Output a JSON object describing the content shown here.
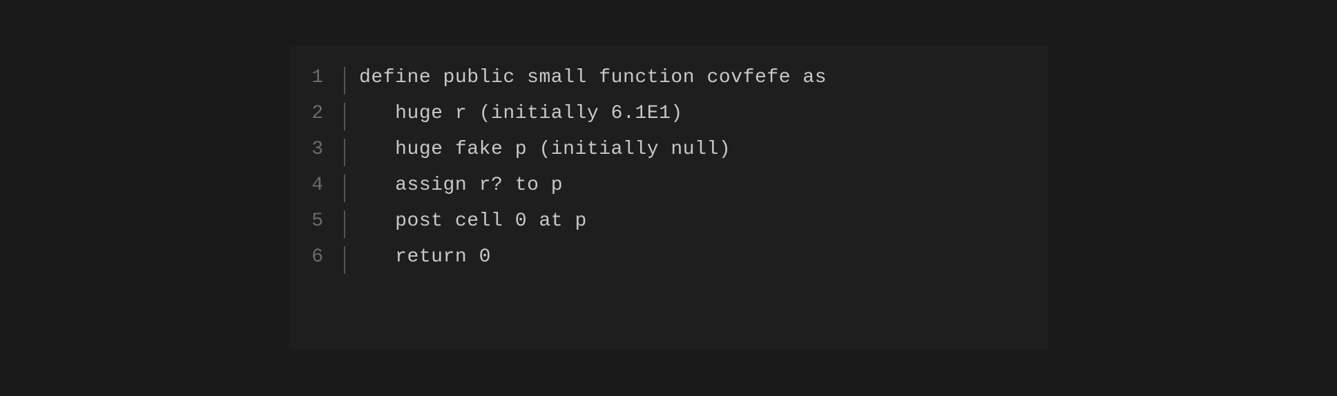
{
  "editor": {
    "background": "#1e1e1e",
    "lines": [
      {
        "number": "1",
        "content": "define public small function covfefe as",
        "indented": false
      },
      {
        "number": "2",
        "content": "   huge r (initially 6.1E1)",
        "indented": true
      },
      {
        "number": "3",
        "content": "   huge fake p (initially null)",
        "indented": true
      },
      {
        "number": "4",
        "content": "   assign r? to p",
        "indented": true
      },
      {
        "number": "5",
        "content": "   post cell 0 at p",
        "indented": true
      },
      {
        "number": "6",
        "content": "   return 0",
        "indented": true
      }
    ]
  }
}
